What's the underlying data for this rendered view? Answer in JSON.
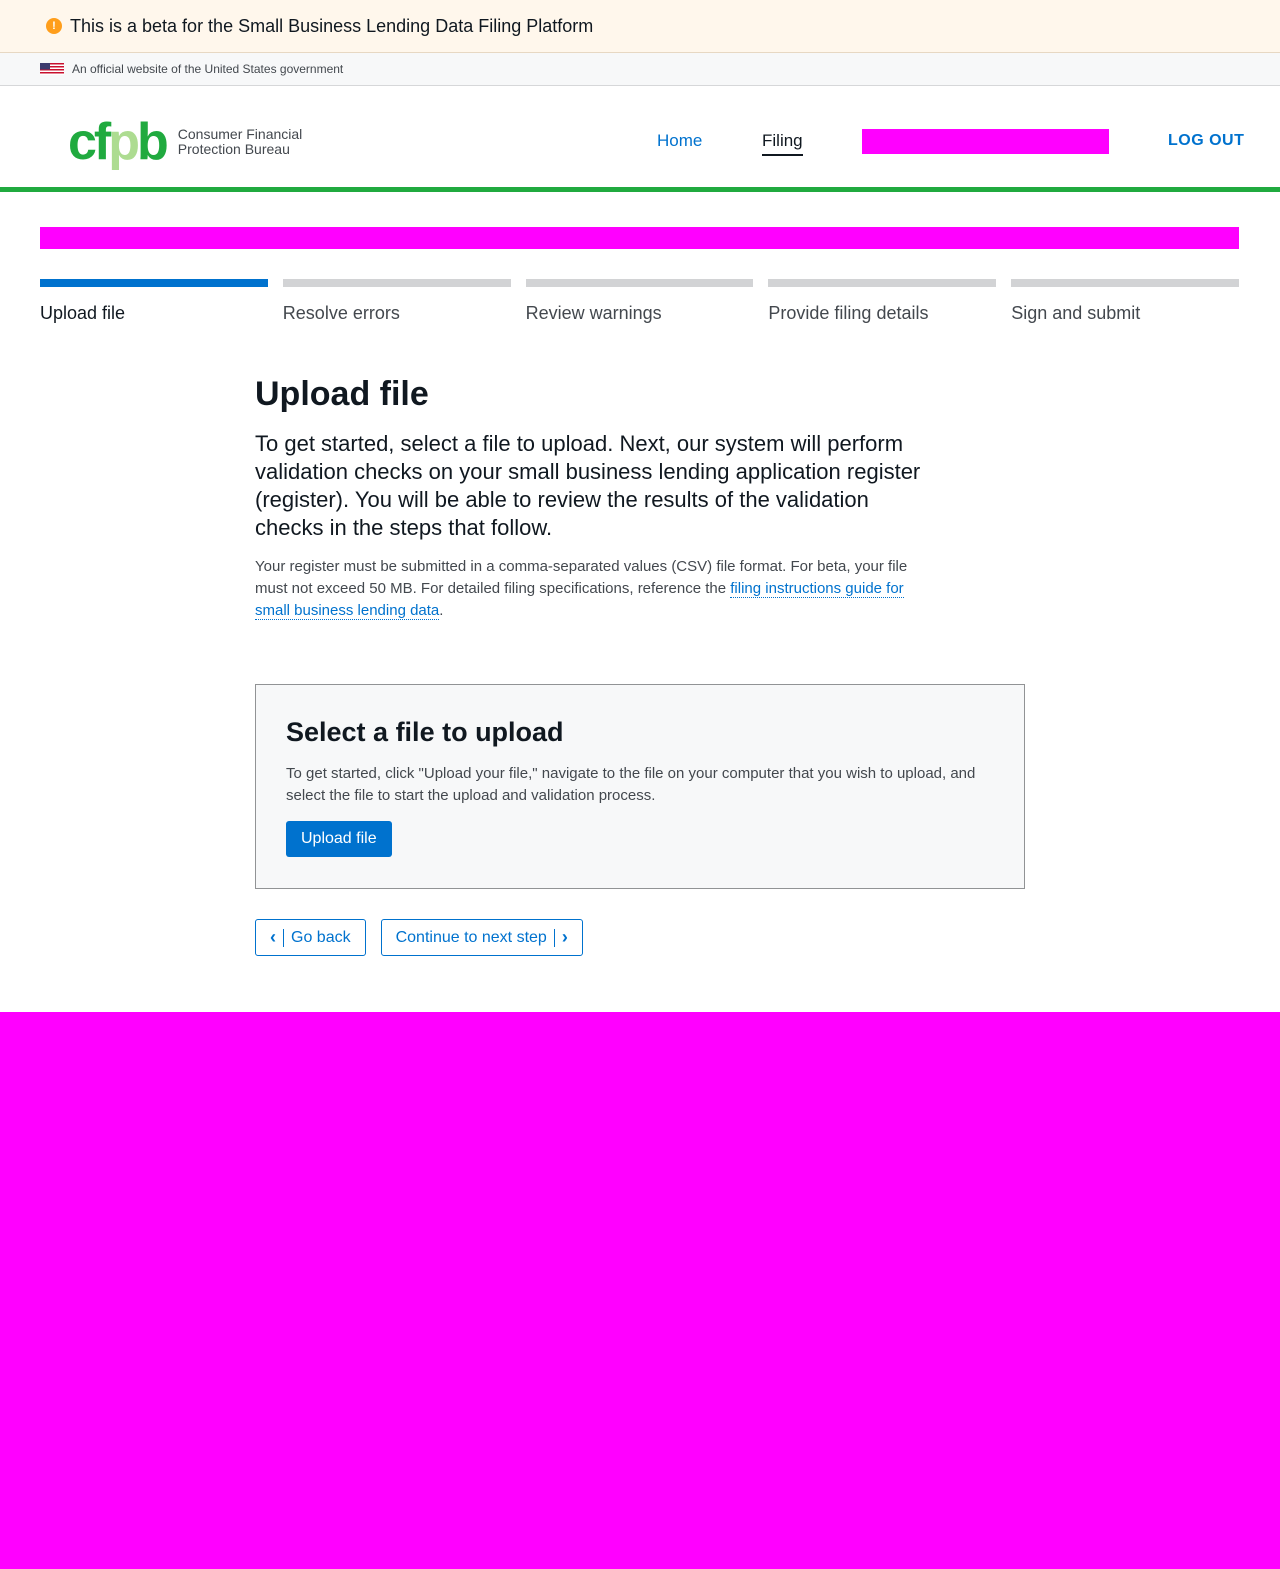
{
  "beta_banner": {
    "text": "This is a beta for the Small Business Lending Data Filing Platform",
    "icon": "alert-icon"
  },
  "gov_banner": {
    "text": "An official website of the United States government",
    "icon": "us-flag-icon"
  },
  "header": {
    "logo_text": "cfpb",
    "logo_line1": "Consumer Financial",
    "logo_line2": "Protection Bureau",
    "nav": {
      "home": "Home",
      "filing": "Filing",
      "logout": "LOG OUT"
    }
  },
  "steps": [
    {
      "label": "Upload file",
      "active": true
    },
    {
      "label": "Resolve errors",
      "active": false
    },
    {
      "label": "Review warnings",
      "active": false
    },
    {
      "label": "Provide filing details",
      "active": false
    },
    {
      "label": "Sign and submit",
      "active": false
    }
  ],
  "main": {
    "title": "Upload file",
    "lead": "To get started, select a file to upload. Next, our system will perform validation checks on your small business lending application register (register). You will be able to review the results of the validation checks in the steps that follow.",
    "body_prefix": "Your register must be submitted in a comma-separated values (CSV) file format. For beta, your file must not exceed 50 MB. For detailed filing specifications, reference the ",
    "body_link": "filing instructions guide for small business lending data",
    "body_suffix": "."
  },
  "upload_box": {
    "title": "Select a file to upload",
    "text": "To get started, click \"Upload your file,\" navigate to the file on your computer that you wish to upload, and select the file to start the upload and validation process.",
    "button": "Upload file"
  },
  "buttons": {
    "back": "Go back",
    "next": "Continue to next step"
  },
  "colors": {
    "brand_green": "#20aa3f",
    "link_blue": "#0072ce",
    "redaction": "#ff00ff"
  }
}
